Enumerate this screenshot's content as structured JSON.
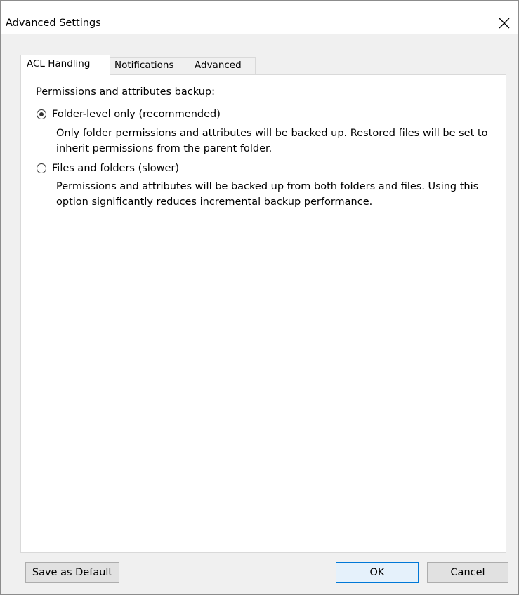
{
  "window": {
    "title": "Advanced Settings",
    "close_icon": "close-icon"
  },
  "tabs": [
    {
      "label": "ACL Handling",
      "active": true
    },
    {
      "label": "Notifications",
      "active": false
    },
    {
      "label": "Advanced",
      "active": false
    }
  ],
  "acl": {
    "section_label": "Permissions and attributes backup:",
    "options": [
      {
        "label": "Folder-level only (recommended)",
        "checked": true,
        "description": "Only folder permissions and attributes will be backed up. Restored files will be set to inherit permissions from the parent folder."
      },
      {
        "label": "Files and folders (slower)",
        "checked": false,
        "description": "Permissions and attributes will be backed up from both folders and files. Using this option significantly reduces incremental backup performance."
      }
    ]
  },
  "buttons": {
    "save_default": "Save as Default",
    "ok": "OK",
    "cancel": "Cancel"
  },
  "colors": {
    "accent": "#0078d7",
    "dialog_bg": "#f0f0f0",
    "panel_bg": "#ffffff"
  }
}
